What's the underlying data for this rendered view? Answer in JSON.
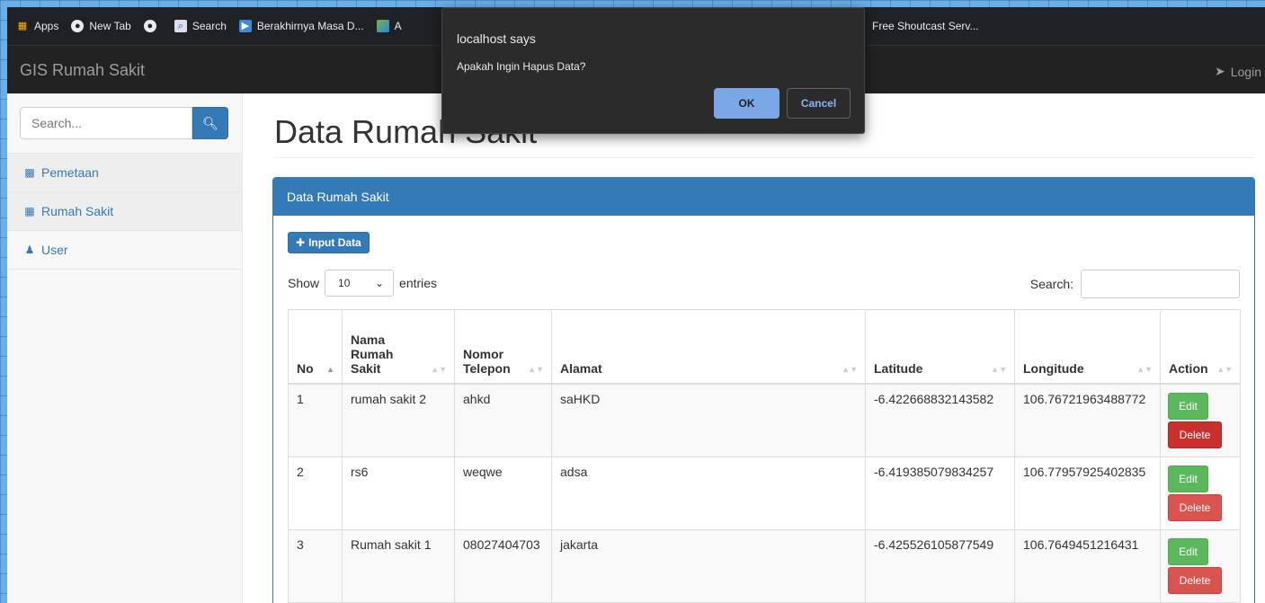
{
  "bookmarks": [
    {
      "icon": "apps-grid-icon",
      "label": "Apps"
    },
    {
      "icon": "globe-icon",
      "label": "New Tab"
    },
    {
      "icon": "globe-icon",
      "label": ""
    },
    {
      "icon": "search-icon",
      "label": "Search"
    },
    {
      "icon": "image-icon",
      "label": "Berakhirnya Masa D..."
    },
    {
      "icon": "picture-icon",
      "label": "A"
    }
  ],
  "bookmark_right": "Free Shoutcast Serv...",
  "navbar": {
    "brand": "GIS Rumah Sakit",
    "login": "Login"
  },
  "sidebar": {
    "search_placeholder": "Search...",
    "items": [
      {
        "icon": "map-icon",
        "label": "Pemetaan"
      },
      {
        "icon": "table-icon",
        "label": "Rumah Sakit"
      },
      {
        "icon": "user-icon",
        "label": "User"
      }
    ]
  },
  "main": {
    "title": "Data Rumah Sakit",
    "panel_title": "Data Rumah Sakit",
    "input_button": "Input Data",
    "show_label": "Show",
    "entries_value": "10",
    "entries_label": "entries",
    "search_label": "Search:"
  },
  "table": {
    "headers": [
      "No",
      "Nama Rumah Sakit",
      "Nomor Telepon",
      "Alamat",
      "Latitude",
      "Longitude",
      "Action"
    ],
    "rows": [
      {
        "no": "1",
        "nama": "rumah sakit 2",
        "telepon": "ahkd",
        "alamat": "saHKD",
        "lat": "-6.422668832143582",
        "lng": "106.76721963488772"
      },
      {
        "no": "2",
        "nama": "rs6",
        "telepon": "weqwe",
        "alamat": "adsa",
        "lat": "-6.419385079834257",
        "lng": "106.77957925402835"
      },
      {
        "no": "3",
        "nama": "Rumah sakit 1",
        "telepon": "08027404703",
        "alamat": "jakarta",
        "lat": "-6.425526105877549",
        "lng": "106.7649451216431"
      }
    ],
    "edit_label": "Edit",
    "delete_label": "Delete"
  },
  "dialog": {
    "title": "localhost says",
    "message": "Apakah Ingin Hapus Data?",
    "ok": "OK",
    "cancel": "Cancel"
  },
  "colors": {
    "primary": "#337ab7",
    "success": "#5cb85c",
    "danger": "#d9534f",
    "navbar": "#222222"
  }
}
